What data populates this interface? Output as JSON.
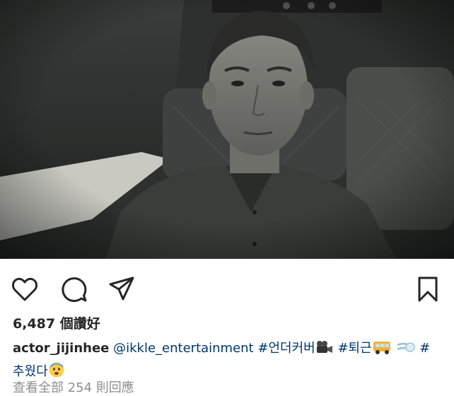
{
  "post": {
    "username": "actor_jijinhee",
    "likes": "6,487 個讚好",
    "caption": {
      "mention": "@ikkle_entertainment",
      "tag1": "#언더커버",
      "tag2": "#퇴근",
      "tag3_start": "#",
      "tag3_end": "추웠다"
    },
    "view_comments": "查看全部 254 則回應"
  },
  "icons": {
    "like": "heart-icon",
    "comment": "comment-icon",
    "share": "paper-plane-icon",
    "save": "bookmark-icon"
  },
  "colors": {
    "text": "#262626",
    "link": "#00376b",
    "secondary": "#8e8e8e"
  }
}
